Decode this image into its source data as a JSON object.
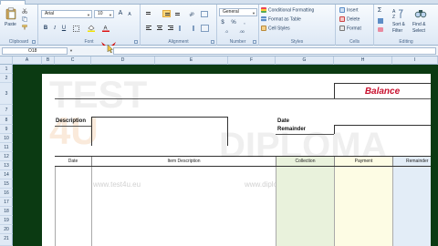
{
  "ribbon": {
    "clipboard": {
      "paste_label": "Paste",
      "group_label": "Clipboard"
    },
    "font": {
      "font_name": "Arial",
      "font_size": "10",
      "bold": "B",
      "italic": "I",
      "underline": "U",
      "grow": "A",
      "shrink": "A",
      "group_label": "Font"
    },
    "alignment": {
      "group_label": "Alignment"
    },
    "number": {
      "format_value": "General",
      "currency": "$",
      "percent": "%",
      "comma": ",",
      "dec_inc": ".0",
      "dec_dec": ".00",
      "group_label": "Number"
    },
    "styles": {
      "conditional_formatting": "Conditional Formatting",
      "format_as_table": "Format as Table",
      "cell_styles": "Cell Styles",
      "group_label": "Styles"
    },
    "cells": {
      "insert": "Insert",
      "delete": "Delete",
      "format": "Format",
      "group_label": "Cells"
    },
    "editing": {
      "sum_symbol": "Σ",
      "sort_filter_line1": "Sort &",
      "sort_filter_line2": "Filter",
      "find_select_line1": "Find &",
      "find_select_line2": "Select",
      "group_label": "Editing"
    }
  },
  "formula_bar": {
    "name_box": "O18",
    "fx_value": ""
  },
  "columns": [
    "A",
    "B",
    "C",
    "D",
    "E",
    "F",
    "G",
    "H",
    "I"
  ],
  "rows": [
    "1",
    "2",
    "3",
    "7",
    "8",
    "9",
    "10",
    "11",
    "12",
    "13",
    "14",
    "15",
    "16",
    "17",
    "18",
    "19",
    "20",
    "21"
  ],
  "sheet": {
    "title": "Balance",
    "description_label": "Description",
    "date_label": "Date",
    "remainder_label": "Remainder",
    "table_headers": [
      "Date",
      "Item Description",
      "Collection",
      "Payment",
      "Remainder"
    ]
  },
  "watermark": {
    "logo_text_1": "TEST",
    "logo_text_2": "4U",
    "logo_text_3": "DIPLOMA",
    "url_1": "www.test4u.eu",
    "url_2": "www.diploma.edu.gr"
  },
  "colors": {
    "balance_title": "#c8102e",
    "collection_fill": "#e9f2dc",
    "payment_fill": "#fdfce4",
    "remainder_fill": "#e3edf7",
    "margin": "#0b3a12"
  }
}
